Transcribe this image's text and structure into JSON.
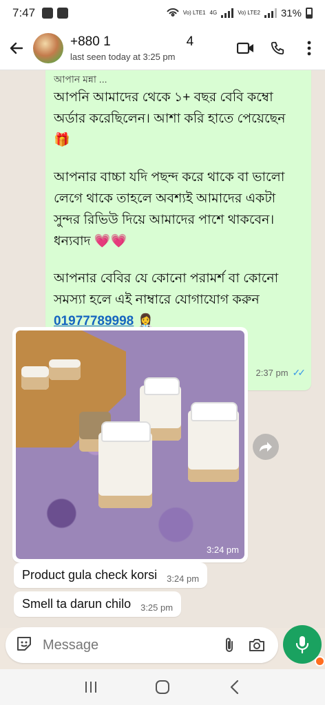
{
  "status_bar": {
    "time": "7:47",
    "battery": "31%",
    "sim1": "Vo) LTE1",
    "sim2": "Vo) LTE2",
    "network": "4G"
  },
  "header": {
    "contact_name_prefix": "+880 1",
    "contact_name_suffix": "4",
    "last_seen": "last seen today at 3:25 pm"
  },
  "messages": {
    "outgoing": {
      "partial_line": "আপনি মুন্না ...",
      "paragraph1": "আপনি আমাদের থেকে ১+ বছর বেবি কম্বো অর্ডার করেছিলেন। আশা করি হাতে পেয়েছেন 🎁",
      "paragraph2": "আপনার বাচ্চা যদি পছন্দ করে থাকে বা ভালো লেগে থাকে তাহলে অবশ্যই আমাদের একটা সুন্দর রিভিউ দিয়ে আমাদের পাশে থাকবেন। ধন্যবাদ 💗💗",
      "paragraph3": "আপনার বেবির যে কোনো পরামর্শ বা কোনো সমস্যা হলে এই নাম্বারে যোগাযোগ করুন",
      "phone": "01977789998",
      "phone_emoji": "👩‍⚕️",
      "time": "2:37 pm",
      "ticks": "✓✓"
    },
    "photo": {
      "time": "3:24 pm"
    },
    "incoming": [
      {
        "text": "Product gula check korsi",
        "time": "3:24 pm"
      },
      {
        "text": "Smell ta darun chilo",
        "time": "3:25 pm"
      }
    ]
  },
  "composer": {
    "placeholder": "Message"
  },
  "colors": {
    "outgoing_bubble": "#d9fdd3",
    "mic_button": "#1aa260",
    "link": "#1565c0",
    "ticks": "#3b9ae6"
  }
}
